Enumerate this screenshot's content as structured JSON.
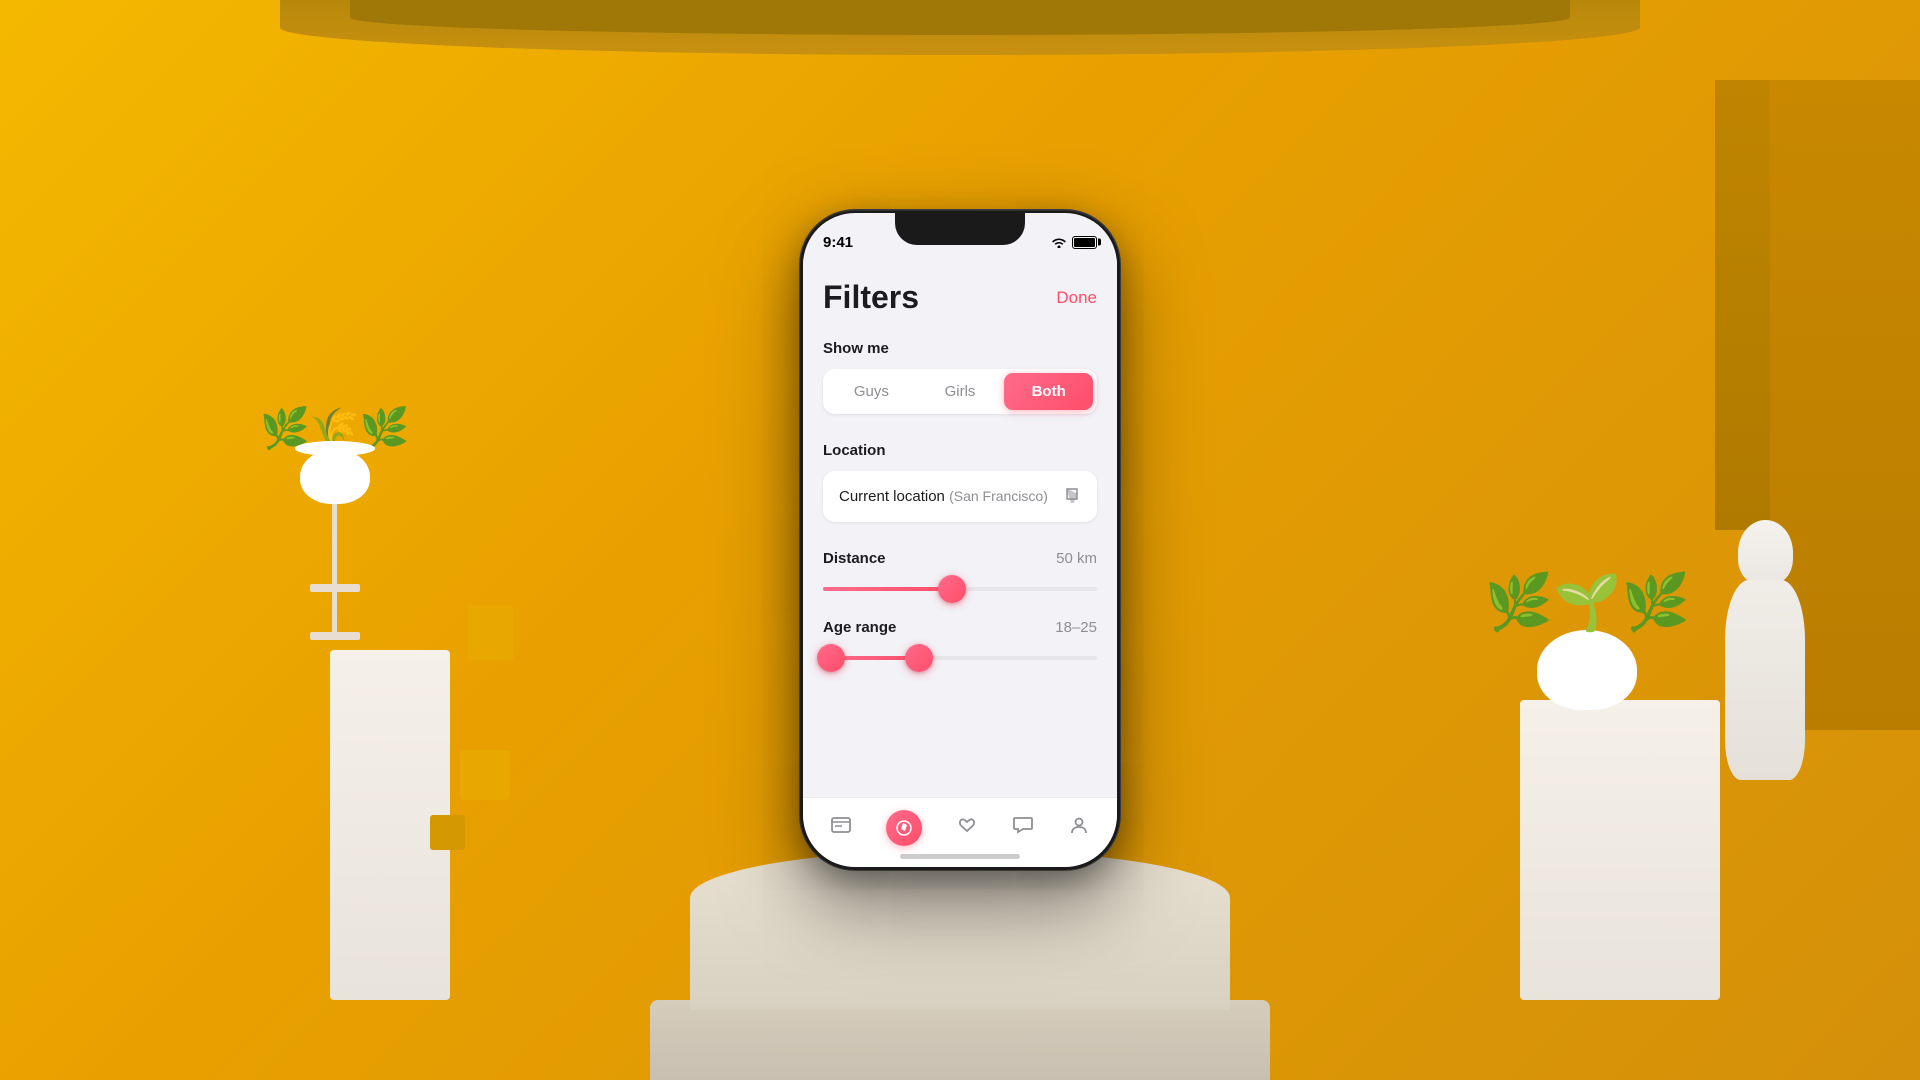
{
  "background": {
    "color": "#F0A800"
  },
  "statusBar": {
    "time": "9:41"
  },
  "header": {
    "title": "Filters",
    "doneLabel": "Done"
  },
  "showMe": {
    "label": "Show me",
    "options": [
      {
        "id": "guys",
        "label": "Guys",
        "active": false
      },
      {
        "id": "girls",
        "label": "Girls",
        "active": false
      },
      {
        "id": "both",
        "label": "Both",
        "active": true
      }
    ]
  },
  "location": {
    "label": "Location",
    "value": "Current location",
    "subValue": "(San Francisco)"
  },
  "distance": {
    "label": "Distance",
    "value": "50 km",
    "fillPercent": 47
  },
  "ageRange": {
    "label": "Age range",
    "value": "18–25",
    "minPercent": 3,
    "maxPercent": 35
  },
  "tabBar": {
    "items": [
      {
        "id": "cards",
        "icon": "📋",
        "active": false
      },
      {
        "id": "discover",
        "icon": "🧭",
        "active": true
      },
      {
        "id": "favorites",
        "icon": "⭐",
        "active": false
      },
      {
        "id": "messages",
        "icon": "💬",
        "active": false
      },
      {
        "id": "profile",
        "icon": "👤",
        "active": false
      }
    ]
  }
}
